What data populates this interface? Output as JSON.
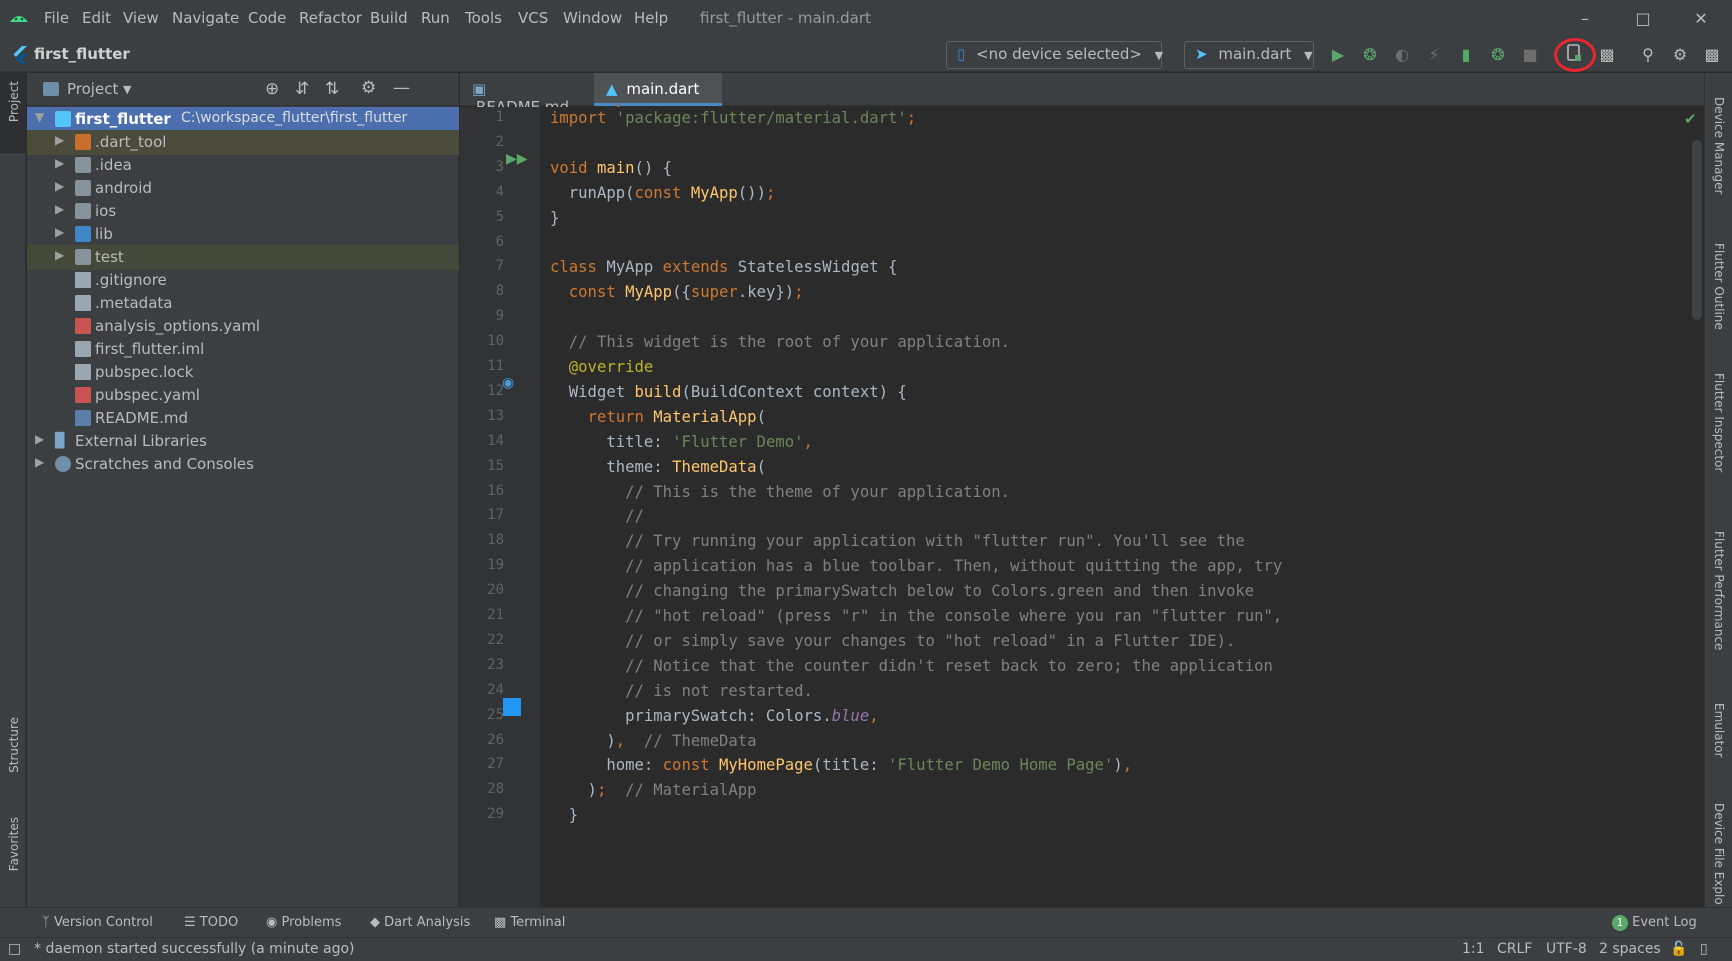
{
  "menu": {
    "items": [
      "File",
      "Edit",
      "View",
      "Navigate",
      "Code",
      "Refactor",
      "Build",
      "Run",
      "Tools",
      "VCS",
      "Window",
      "Help"
    ],
    "window_title": "first_flutter - main.dart"
  },
  "navbar": {
    "project_name": "first_flutter",
    "device_selector": "<no device selected>",
    "run_config": "main.dart"
  },
  "left_stripe": {
    "project": "Project",
    "structure": "Structure",
    "favorites": "Favorites"
  },
  "project_panel": {
    "title": "Project",
    "root_name": "first_flutter",
    "root_path": "C:\\workspace_flutter\\first_flutter",
    "items": [
      {
        "label": ".dart_tool",
        "type": "folder-orange",
        "expandable": true
      },
      {
        "label": ".idea",
        "type": "folder",
        "expandable": true
      },
      {
        "label": "android",
        "type": "folder",
        "expandable": true
      },
      {
        "label": "ios",
        "type": "folder",
        "expandable": true
      },
      {
        "label": "lib",
        "type": "folder-blue",
        "expandable": true
      },
      {
        "label": "test",
        "type": "folder",
        "expandable": true
      },
      {
        "label": ".gitignore",
        "type": "file",
        "expandable": false
      },
      {
        "label": ".metadata",
        "type": "file",
        "expandable": false
      },
      {
        "label": "analysis_options.yaml",
        "type": "yaml",
        "expandable": false
      },
      {
        "label": "first_flutter.iml",
        "type": "file",
        "expandable": false
      },
      {
        "label": "pubspec.lock",
        "type": "file",
        "expandable": false
      },
      {
        "label": "pubspec.yaml",
        "type": "yaml",
        "expandable": false
      },
      {
        "label": "README.md",
        "type": "md",
        "expandable": false
      }
    ],
    "external_libraries": "External Libraries",
    "scratches": "Scratches and Consoles"
  },
  "editor": {
    "tabs": [
      {
        "label": "README.md",
        "active": false
      },
      {
        "label": "main.dart",
        "active": true
      }
    ],
    "lines": [
      "import 'package:flutter/material.dart';",
      "",
      "void main() {",
      "  runApp(const MyApp());",
      "}",
      "",
      "class MyApp extends StatelessWidget {",
      "  const MyApp({super.key});",
      "",
      "  // This widget is the root of your application.",
      "  @override",
      "  Widget build(BuildContext context) {",
      "    return MaterialApp(",
      "      title: 'Flutter Demo',",
      "      theme: ThemeData(",
      "        // This is the theme of your application.",
      "        //",
      "        // Try running your application with \"flutter run\". You'll see the",
      "        // application has a blue toolbar. Then, without quitting the app, try",
      "        // changing the primarySwatch below to Colors.green and then invoke",
      "        // \"hot reload\" (press \"r\" in the console where you ran \"flutter run\",",
      "        // or simply save your changes to \"hot reload\" in a Flutter IDE).",
      "        // Notice that the counter didn't reset back to zero; the application",
      "        // is not restarted.",
      "        primarySwatch: Colors.blue,",
      "      ),  // ThemeData",
      "      home: const MyHomePage(title: 'Flutter Demo Home Page'),",
      "    );  // MaterialApp",
      "  }"
    ]
  },
  "right_stripe": [
    "Device Manager",
    "Flutter Outline",
    "Flutter Inspector",
    "Flutter Performance",
    "Emulator",
    "Device File Explo"
  ],
  "bottom_tools": [
    "Version Control",
    "TODO",
    "Problems",
    "Dart Analysis",
    "Terminal"
  ],
  "event_log": {
    "label": "Event Log",
    "count": "1"
  },
  "status": {
    "message": "* daemon started successfully (a minute ago)",
    "position": "1:1",
    "line_sep": "CRLF",
    "encoding": "UTF-8",
    "indent": "2 spaces"
  },
  "colors": {
    "accent": "#4a88c7",
    "selection": "#4b6eaf",
    "highlight_circle": "#e8262d",
    "run_green": "#59a869"
  }
}
